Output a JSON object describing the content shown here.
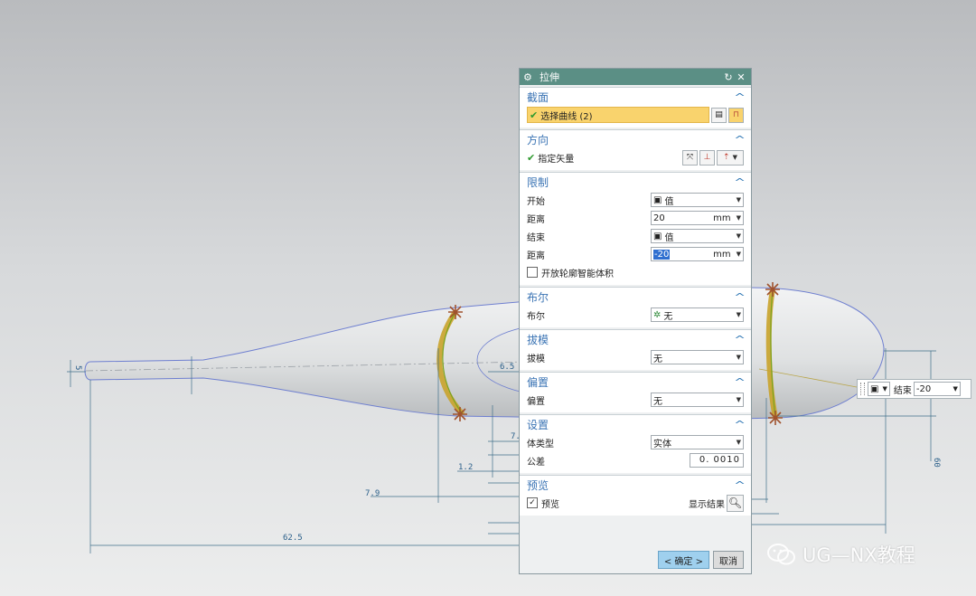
{
  "dialog": {
    "title": "拉伸",
    "sections": {
      "section_curve": {
        "title": "截面",
        "select_label": "选择曲线 (2)"
      },
      "direction": {
        "title": "方向",
        "vector_label": "指定矢量"
      },
      "limits": {
        "title": "限制",
        "start_label": "开始",
        "start_value": "值",
        "dist1_label": "距离",
        "dist1_value": "20",
        "dist1_unit": "mm",
        "end_label": "结束",
        "end_value": "值",
        "dist2_label": "距离",
        "dist2_value": "-20",
        "dist2_unit": "mm",
        "open_profile_label": "开放轮廓智能体积"
      },
      "boolean": {
        "title": "布尔",
        "row_label": "布尔",
        "value": "无"
      },
      "draft": {
        "title": "拔模",
        "row_label": "拔模",
        "value": "无"
      },
      "offset": {
        "title": "偏置",
        "row_label": "偏置",
        "value": "无"
      },
      "settings": {
        "title": "设置",
        "body_type_label": "体类型",
        "body_type_value": "实体",
        "tolerance_label": "公差",
        "tolerance_value": "0. 0010"
      },
      "preview": {
        "title": "预览",
        "preview_label": "预览",
        "show_result_label": "显示结果"
      }
    },
    "ok_label": "< 确定 >",
    "cancel_label": "取消"
  },
  "mini_toolbar": {
    "end_label": "结束",
    "value": "-20"
  },
  "dimensions": [
    "6.5",
    "7.",
    "1.2",
    "7.9",
    "62.5",
    "60",
    "5"
  ],
  "watermark": "UG—NX教程",
  "colors": {
    "titlebar": "#5b8f85",
    "selection_highlight": "#f9d36d",
    "ok_button": "#9fd0ee",
    "curve": "#c9a32b"
  }
}
